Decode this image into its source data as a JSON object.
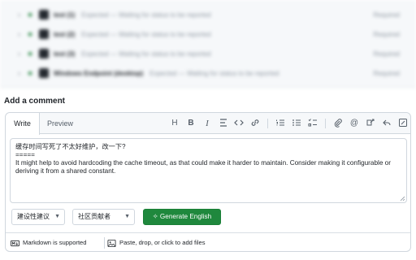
{
  "checks": {
    "rows": [
      {
        "name": "test (1)",
        "description": "Expected — Waiting for status to be reported",
        "status": "Required"
      },
      {
        "name": "test (2)",
        "description": "Expected — Waiting for status to be reported",
        "status": "Required"
      },
      {
        "name": "test (3)",
        "description": "Expected — Waiting for status to be reported",
        "status": "Required"
      },
      {
        "name": "test (4)",
        "description": "Expected — Waiting for status to be reported",
        "status": "Required"
      },
      {
        "name": "Windows Endpoint (desktop)",
        "description": "Expected — Waiting for status to be reported",
        "status": "Required"
      }
    ]
  },
  "comment": {
    "heading": "Add a comment",
    "tabs": {
      "write": "Write",
      "preview": "Preview"
    },
    "toolbar": {
      "heading": "H",
      "bold": "B",
      "italic": "I",
      "quote": "quote-icon",
      "code": "code-icon",
      "link": "link-icon",
      "ordered_list": "ordered-list-icon",
      "unordered_list": "unordered-list-icon",
      "task_list": "task-list-icon",
      "attach": "paperclip-icon",
      "mention": "at-icon",
      "reference": "cross-reference-icon",
      "reply": "reply-icon",
      "fullscreen": "fullscreen-icon"
    },
    "body": {
      "line1": "缓存时间写死了不太好维护，改一下?",
      "line2": "=====",
      "line3": "It might help to avoid hardcoding the cache timeout, as that could make it harder to maintain. Consider making it configurable or deriving it from a shared constant."
    },
    "actions": {
      "type_select": "建设性建议",
      "role_select": "社区贡献者",
      "generate_button": "✧ Generate English"
    },
    "footer": {
      "markdown": "Markdown is supported",
      "attach": "Paste, drop, or click to add files"
    }
  },
  "colors": {
    "accent_green": "#1f883d",
    "border": "#d0d7de",
    "muted": "#57606a"
  }
}
